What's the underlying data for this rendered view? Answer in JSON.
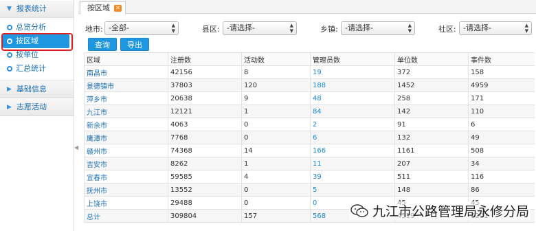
{
  "sidebar": {
    "groups": [
      {
        "label": "报表统计",
        "expanded": true,
        "items": [
          {
            "label": "总览分析",
            "active": false
          },
          {
            "label": "按区域",
            "active": true
          },
          {
            "label": "按单位",
            "active": false
          },
          {
            "label": "汇总统计",
            "active": false
          }
        ]
      },
      {
        "label": "基础信息",
        "expanded": false
      },
      {
        "label": "志愿活动",
        "expanded": false
      }
    ]
  },
  "tabs": [
    {
      "label": "按区域",
      "close_icon": "close-icon"
    }
  ],
  "filters": {
    "city": {
      "label": "地市:",
      "value": "-全部-"
    },
    "county": {
      "label": "县区:",
      "value": "-请选择-"
    },
    "town": {
      "label": "乡镇:",
      "value": "-请选择-"
    },
    "community": {
      "label": "社区:",
      "value": "-请选择-"
    }
  },
  "actions": {
    "query": "查询",
    "export": "导出"
  },
  "table": {
    "headers": [
      "区域",
      "注册数",
      "活动数",
      "管理员数",
      "单位数",
      "事件数"
    ],
    "rows": [
      [
        "南昌市",
        "42156",
        "8",
        "19",
        "372",
        "158"
      ],
      [
        "景德镇市",
        "37803",
        "120",
        "188",
        "1452",
        "4959"
      ],
      [
        "萍乡市",
        "20638",
        "9",
        "48",
        "258",
        "171"
      ],
      [
        "九江市",
        "12121",
        "1",
        "84",
        "142",
        "110"
      ],
      [
        "新余市",
        "4063",
        "0",
        "2",
        "91",
        "6"
      ],
      [
        "鹰潭市",
        "7768",
        "0",
        "6",
        "132",
        "49"
      ],
      [
        "赣州市",
        "74368",
        "14",
        "166",
        "1161",
        "508"
      ],
      [
        "吉安市",
        "8262",
        "1",
        "11",
        "207",
        "34"
      ],
      [
        "宜春市",
        "59585",
        "4",
        "39",
        "511",
        "116"
      ],
      [
        "抚州市",
        "13552",
        "0",
        "5",
        "148",
        "86"
      ],
      [
        "上饶市",
        "29488",
        "0",
        "0",
        "45",
        "45"
      ],
      [
        "总计",
        "309804",
        "157",
        "568",
        "4519",
        "6201"
      ]
    ]
  },
  "watermark": {
    "text": "九江市公路管理局永修分局"
  },
  "colors": {
    "accent": "#1f96e0",
    "link": "#1a6fb5",
    "highlight_outline": "#e02020"
  }
}
